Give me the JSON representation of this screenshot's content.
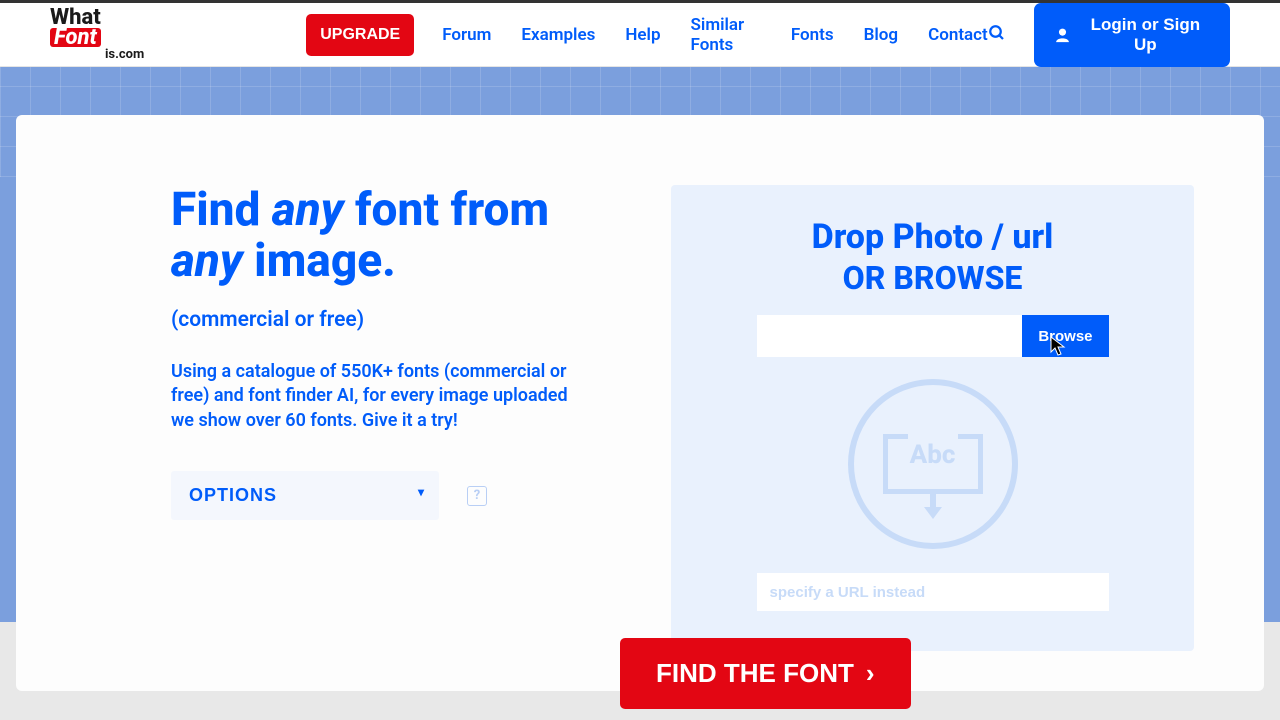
{
  "logo": {
    "part1": "What",
    "part2": "Font",
    "part3": "is.com"
  },
  "nav": {
    "upgrade": "UPGRADE",
    "links": [
      "Forum",
      "Examples",
      "Help",
      "Similar Fonts",
      "Fonts",
      "Blog",
      "Contact"
    ],
    "login": "Login or Sign Up"
  },
  "hero": {
    "h1a": "Find ",
    "h1any1": "any",
    "h1b": " font from ",
    "h1any2": "any",
    "h1c": " image.",
    "sub": "(commercial or free)",
    "desc": "Using a catalogue of 550K+ fonts (commercial or free) and font finder AI, for every image uploaded we show over 60 fonts. Give it a try!",
    "options": "OPTIONS",
    "help": "?"
  },
  "upload": {
    "line1": "Drop Photo / url",
    "line2": "OR BROWSE",
    "browse": "Browse",
    "abc": "Abc",
    "url_placeholder": "specify a URL instead"
  },
  "cta": {
    "find": "FIND THE FONT"
  }
}
